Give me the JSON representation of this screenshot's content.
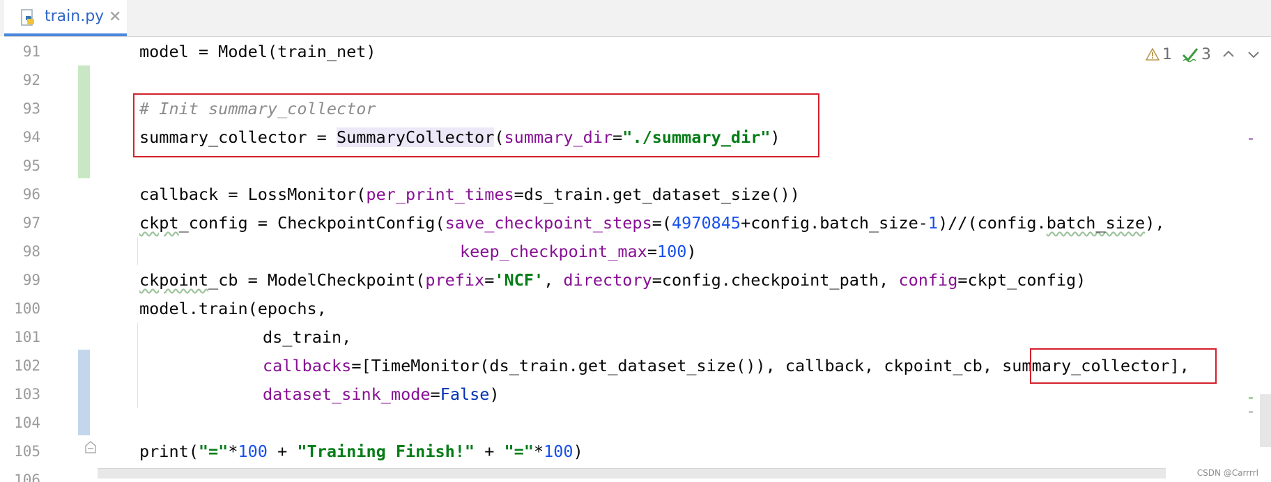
{
  "tab": {
    "filename": "train.py",
    "close": "✕"
  },
  "line_numbers": [
    "91",
    "92",
    "93",
    "94",
    "95",
    "96",
    "97",
    "98",
    "99",
    "100",
    "101",
    "102",
    "103",
    "104",
    "105",
    "106"
  ],
  "code": {
    "l91": {
      "a": "model = Model(train_net)"
    },
    "l93": {
      "a": "# Init summary_collector"
    },
    "l94": {
      "a": "summary_collector = ",
      "b": "SummaryCollector",
      "c": "(",
      "d": "summary_dir",
      "e": "=",
      "f": "\"./summary_dir\"",
      "g": ")"
    },
    "l96": {
      "a": "callback = LossMonitor(",
      "b": "per_print_times",
      "c": "=ds_train.get_dataset_size())"
    },
    "l97": {
      "a": "ckpt",
      "b": "_config = CheckpointConfig(",
      "c": "save_checkpoint_steps",
      "d": "=(",
      "e": "4970845",
      "f": "+config.batch_size-",
      "g": "1",
      "h": ")//(config.",
      "i": "batch_size",
      "j": "),"
    },
    "l98": {
      "a": "keep_checkpoint_max",
      "b": "=",
      "c": "100",
      "d": ")"
    },
    "l99": {
      "a": "ckpoint",
      "b": "_cb = ModelCheckpoint(",
      "c": "prefix",
      "d": "=",
      "e": "'NCF'",
      "f": ", ",
      "g": "directory",
      "h": "=config.checkpoint_path, ",
      "i": "config",
      "j": "=ckpt_config)"
    },
    "l100": {
      "a": "model.train(epochs,"
    },
    "l101": {
      "a": "ds_train,"
    },
    "l102": {
      "a": "callbacks",
      "b": "=[TimeMonitor(ds_train.get_dataset_size()), callback, ckpoint_cb, ",
      "c": "summary_collector",
      "d": "],"
    },
    "l103": {
      "a": "dataset_sink_mode",
      "b": "=",
      "c": "False",
      "d": ")"
    },
    "l105": {
      "a": "print(",
      "b": "\"=\"",
      "c": "*",
      "d": "100",
      "e": " + ",
      "f": "\"Training Finish!\"",
      "g": " + ",
      "h": "\"=\"",
      "i": "*",
      "j": "100",
      "k": ")"
    }
  },
  "inspections": {
    "warnings": "1",
    "weak_warnings": "3"
  },
  "icons": [
    "python-file-icon",
    "close-icon",
    "warning-icon",
    "weak-warning-icon",
    "chevron-up-icon",
    "chevron-down-icon",
    "fold-marker-icon"
  ],
  "colors": {
    "accent": "#4a87dd",
    "highlight_box": "#d4202c",
    "vcs_added": "#c9e7c4",
    "vcs_modified": "#c3d6ec"
  },
  "watermark": "CSDN @Carrrrl"
}
